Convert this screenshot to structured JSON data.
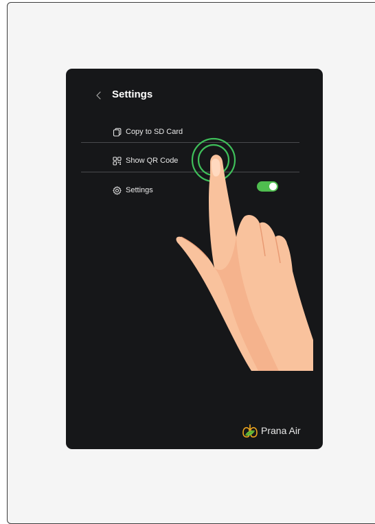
{
  "header": {
    "title": "Settings",
    "back_icon": "chevron-left-icon"
  },
  "menu": {
    "items": [
      {
        "label": "Copy to SD Card",
        "icon": "copy-icon"
      },
      {
        "label": "Show QR Code",
        "icon": "qr-code-icon"
      },
      {
        "label": "Settings",
        "icon": "gear-icon",
        "toggle_on": true
      }
    ]
  },
  "brand": {
    "name": "Prana Air",
    "logo": "lungs-leaf-logo"
  },
  "colors": {
    "screen_bg": "#161719",
    "toggle_on": "#4fbd4f",
    "tap_ring": "#3fbf5a",
    "text": "#e9e9e9"
  }
}
